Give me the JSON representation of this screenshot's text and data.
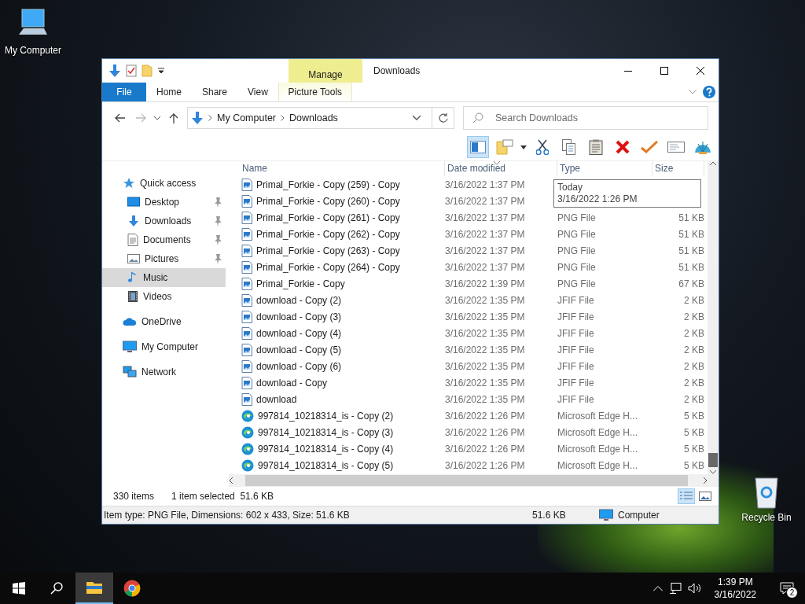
{
  "desktop_icons": [
    {
      "label": "My Computer",
      "kind": "computer"
    },
    {
      "label": "Recycle Bin",
      "kind": "recycle"
    }
  ],
  "window": {
    "title": "Downloads",
    "contextual_group": "Manage"
  },
  "ribbon_tabs": [
    {
      "label": "File",
      "kind": "file"
    },
    {
      "label": "Home",
      "kind": "tab"
    },
    {
      "label": "Share",
      "kind": "tab"
    },
    {
      "label": "View",
      "kind": "tab"
    },
    {
      "label": "Picture Tools",
      "kind": "contextual"
    }
  ],
  "address_bar": {
    "path": [
      "My Computer",
      "Downloads"
    ]
  },
  "search": {
    "placeholder": "Search Downloads"
  },
  "sidebar": {
    "items": [
      {
        "label": "Quick access",
        "kind": "star",
        "selected": false,
        "children": [
          {
            "label": "Desktop",
            "kind": "desktop",
            "selected": false,
            "pinned": true
          },
          {
            "label": "Downloads",
            "kind": "download",
            "selected": false,
            "pinned": true
          },
          {
            "label": "Documents",
            "kind": "document",
            "selected": false,
            "pinned": true
          },
          {
            "label": "Pictures",
            "kind": "picture",
            "selected": false,
            "pinned": true
          },
          {
            "label": "Music",
            "kind": "music",
            "selected": true,
            "pinned": false
          },
          {
            "label": "Videos",
            "kind": "video",
            "selected": false,
            "pinned": false
          }
        ]
      },
      {
        "label": "OneDrive",
        "kind": "cloud",
        "selected": false
      },
      {
        "label": "My Computer",
        "kind": "computer",
        "selected": false
      },
      {
        "label": "Network",
        "kind": "network",
        "selected": false
      }
    ]
  },
  "table": {
    "columns": [
      {
        "label": "Name",
        "sorted": false
      },
      {
        "label": "Date modified",
        "sorted": true
      },
      {
        "label": "Type",
        "sorted": false
      },
      {
        "label": "Size",
        "sorted": false
      }
    ],
    "rows": [
      {
        "kind": "image",
        "name": "Primal_Forkie - Copy (259) - Copy",
        "date": "3/16/2022 1:37 PM"
      },
      {
        "kind": "image",
        "name": "Primal_Forkie - Copy (260) - Copy",
        "date": "3/16/2022 1:37 PM"
      },
      {
        "kind": "image",
        "name": "Primal_Forkie - Copy (261) - Copy",
        "date": "3/16/2022 1:37 PM",
        "type": "PNG File",
        "size": "51 KB"
      },
      {
        "kind": "image",
        "name": "Primal_Forkie - Copy (262) - Copy",
        "date": "3/16/2022 1:37 PM",
        "type": "PNG File",
        "size": "51 KB"
      },
      {
        "kind": "image",
        "name": "Primal_Forkie - Copy (263) - Copy",
        "date": "3/16/2022 1:37 PM",
        "type": "PNG File",
        "size": "51 KB"
      },
      {
        "kind": "image",
        "name": "Primal_Forkie - Copy (264) - Copy",
        "date": "3/16/2022 1:37 PM",
        "type": "PNG File",
        "size": "51 KB"
      },
      {
        "kind": "image",
        "name": "Primal_Forkie - Copy",
        "date": "3/16/2022 1:39 PM",
        "type": "PNG File",
        "size": "67 KB"
      },
      {
        "kind": "image",
        "name": "download - Copy (2)",
        "date": "3/16/2022 1:35 PM",
        "type": "JFIF File",
        "size": "2 KB"
      },
      {
        "kind": "image",
        "name": "download - Copy (3)",
        "date": "3/16/2022 1:35 PM",
        "type": "JFIF File",
        "size": "2 KB"
      },
      {
        "kind": "image",
        "name": "download - Copy (4)",
        "date": "3/16/2022 1:35 PM",
        "type": "JFIF File",
        "size": "2 KB"
      },
      {
        "kind": "image",
        "name": "download - Copy (5)",
        "date": "3/16/2022 1:35 PM",
        "type": "JFIF File",
        "size": "2 KB"
      },
      {
        "kind": "image",
        "name": "download - Copy (6)",
        "date": "3/16/2022 1:35 PM",
        "type": "JFIF File",
        "size": "2 KB"
      },
      {
        "kind": "image",
        "name": "download - Copy",
        "date": "3/16/2022 1:35 PM",
        "type": "JFIF File",
        "size": "2 KB"
      },
      {
        "kind": "image",
        "name": "download",
        "date": "3/16/2022 1:35 PM",
        "type": "JFIF File",
        "size": "2 KB"
      },
      {
        "kind": "edge",
        "name": "997814_10218314_is - Copy (2)",
        "date": "3/16/2022 1:26 PM",
        "type": "Microsoft Edge H...",
        "size": "5 KB"
      },
      {
        "kind": "edge",
        "name": "997814_10218314_is - Copy (3)",
        "date": "3/16/2022 1:26 PM",
        "type": "Microsoft Edge H...",
        "size": "5 KB"
      },
      {
        "kind": "edge",
        "name": "997814_10218314_is - Copy (4)",
        "date": "3/16/2022 1:26 PM",
        "type": "Microsoft Edge H...",
        "size": "5 KB"
      },
      {
        "kind": "edge",
        "name": "997814_10218314_is - Copy (5)",
        "date": "3/16/2022 1:26 PM",
        "type": "Microsoft Edge H...",
        "size": "5 KB"
      }
    ]
  },
  "tooltip": {
    "lines": [
      "Today",
      "3/16/2022 1:26 PM"
    ]
  },
  "status_bar": {
    "item_count": "330 items",
    "selection": "1 item selected",
    "selection_size": "51.6 KB"
  },
  "details_bar": {
    "text": "Item type: PNG File, Dimensions: 602 x 433, Size: 51.6 KB",
    "size": "51.6 KB",
    "location": "Computer"
  },
  "taskbar": {
    "apps": [
      {
        "kind": "explorer",
        "active": true
      },
      {
        "kind": "chrome",
        "active": false
      }
    ],
    "time": "1:39 PM",
    "date": "3/16/2022",
    "notifications": "2"
  }
}
